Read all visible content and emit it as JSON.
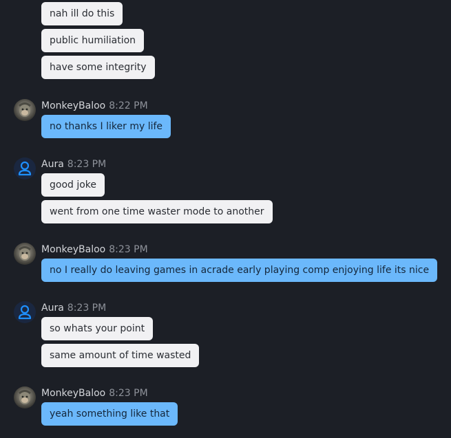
{
  "messages": [
    {
      "text": "nah ill do this"
    },
    {
      "text": "public humiliation"
    },
    {
      "text": "have some integrity"
    }
  ],
  "groups": [
    {
      "author": "MonkeyBaloo",
      "time": "8:22 PM",
      "avatar": "monkey-avatar",
      "messages": [
        "no thanks I liker my life"
      ]
    },
    {
      "author": "Aura",
      "time": "8:23 PM",
      "avatar": "user-icon",
      "messages": [
        "good joke",
        "went from one time waster mode to another"
      ]
    },
    {
      "author": "MonkeyBaloo",
      "time": "8:23 PM",
      "avatar": "monkey-avatar",
      "messages": [
        "no I really do leaving games in acrade early playing comp enjoying life its nice"
      ]
    },
    {
      "author": "Aura",
      "time": "8:23 PM",
      "avatar": "user-icon",
      "messages": [
        "so whats your point",
        "same amount of time wasted"
      ]
    },
    {
      "author": "MonkeyBaloo",
      "time": "8:23 PM",
      "avatar": "monkey-avatar",
      "messages": [
        "yeah something like that"
      ]
    }
  ],
  "colors": {
    "background": "#1c1f26",
    "own_bubble": "#6bb8fb",
    "other_bubble": "#f1f1f3",
    "user_icon": "#1e90ff"
  }
}
